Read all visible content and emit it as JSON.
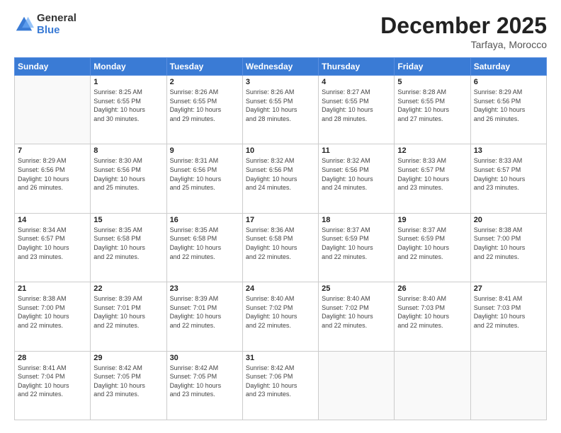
{
  "logo": {
    "general": "General",
    "blue": "Blue"
  },
  "header": {
    "month": "December 2025",
    "location": "Tarfaya, Morocco"
  },
  "weekdays": [
    "Sunday",
    "Monday",
    "Tuesday",
    "Wednesday",
    "Thursday",
    "Friday",
    "Saturday"
  ],
  "weeks": [
    [
      {
        "day": "",
        "info": ""
      },
      {
        "day": "1",
        "info": "Sunrise: 8:25 AM\nSunset: 6:55 PM\nDaylight: 10 hours\nand 30 minutes."
      },
      {
        "day": "2",
        "info": "Sunrise: 8:26 AM\nSunset: 6:55 PM\nDaylight: 10 hours\nand 29 minutes."
      },
      {
        "day": "3",
        "info": "Sunrise: 8:26 AM\nSunset: 6:55 PM\nDaylight: 10 hours\nand 28 minutes."
      },
      {
        "day": "4",
        "info": "Sunrise: 8:27 AM\nSunset: 6:55 PM\nDaylight: 10 hours\nand 28 minutes."
      },
      {
        "day": "5",
        "info": "Sunrise: 8:28 AM\nSunset: 6:55 PM\nDaylight: 10 hours\nand 27 minutes."
      },
      {
        "day": "6",
        "info": "Sunrise: 8:29 AM\nSunset: 6:56 PM\nDaylight: 10 hours\nand 26 minutes."
      }
    ],
    [
      {
        "day": "7",
        "info": "Sunrise: 8:29 AM\nSunset: 6:56 PM\nDaylight: 10 hours\nand 26 minutes."
      },
      {
        "day": "8",
        "info": "Sunrise: 8:30 AM\nSunset: 6:56 PM\nDaylight: 10 hours\nand 25 minutes."
      },
      {
        "day": "9",
        "info": "Sunrise: 8:31 AM\nSunset: 6:56 PM\nDaylight: 10 hours\nand 25 minutes."
      },
      {
        "day": "10",
        "info": "Sunrise: 8:32 AM\nSunset: 6:56 PM\nDaylight: 10 hours\nand 24 minutes."
      },
      {
        "day": "11",
        "info": "Sunrise: 8:32 AM\nSunset: 6:56 PM\nDaylight: 10 hours\nand 24 minutes."
      },
      {
        "day": "12",
        "info": "Sunrise: 8:33 AM\nSunset: 6:57 PM\nDaylight: 10 hours\nand 23 minutes."
      },
      {
        "day": "13",
        "info": "Sunrise: 8:33 AM\nSunset: 6:57 PM\nDaylight: 10 hours\nand 23 minutes."
      }
    ],
    [
      {
        "day": "14",
        "info": "Sunrise: 8:34 AM\nSunset: 6:57 PM\nDaylight: 10 hours\nand 23 minutes."
      },
      {
        "day": "15",
        "info": "Sunrise: 8:35 AM\nSunset: 6:58 PM\nDaylight: 10 hours\nand 22 minutes."
      },
      {
        "day": "16",
        "info": "Sunrise: 8:35 AM\nSunset: 6:58 PM\nDaylight: 10 hours\nand 22 minutes."
      },
      {
        "day": "17",
        "info": "Sunrise: 8:36 AM\nSunset: 6:58 PM\nDaylight: 10 hours\nand 22 minutes."
      },
      {
        "day": "18",
        "info": "Sunrise: 8:37 AM\nSunset: 6:59 PM\nDaylight: 10 hours\nand 22 minutes."
      },
      {
        "day": "19",
        "info": "Sunrise: 8:37 AM\nSunset: 6:59 PM\nDaylight: 10 hours\nand 22 minutes."
      },
      {
        "day": "20",
        "info": "Sunrise: 8:38 AM\nSunset: 7:00 PM\nDaylight: 10 hours\nand 22 minutes."
      }
    ],
    [
      {
        "day": "21",
        "info": "Sunrise: 8:38 AM\nSunset: 7:00 PM\nDaylight: 10 hours\nand 22 minutes."
      },
      {
        "day": "22",
        "info": "Sunrise: 8:39 AM\nSunset: 7:01 PM\nDaylight: 10 hours\nand 22 minutes."
      },
      {
        "day": "23",
        "info": "Sunrise: 8:39 AM\nSunset: 7:01 PM\nDaylight: 10 hours\nand 22 minutes."
      },
      {
        "day": "24",
        "info": "Sunrise: 8:40 AM\nSunset: 7:02 PM\nDaylight: 10 hours\nand 22 minutes."
      },
      {
        "day": "25",
        "info": "Sunrise: 8:40 AM\nSunset: 7:02 PM\nDaylight: 10 hours\nand 22 minutes."
      },
      {
        "day": "26",
        "info": "Sunrise: 8:40 AM\nSunset: 7:03 PM\nDaylight: 10 hours\nand 22 minutes."
      },
      {
        "day": "27",
        "info": "Sunrise: 8:41 AM\nSunset: 7:03 PM\nDaylight: 10 hours\nand 22 minutes."
      }
    ],
    [
      {
        "day": "28",
        "info": "Sunrise: 8:41 AM\nSunset: 7:04 PM\nDaylight: 10 hours\nand 22 minutes."
      },
      {
        "day": "29",
        "info": "Sunrise: 8:42 AM\nSunset: 7:05 PM\nDaylight: 10 hours\nand 23 minutes."
      },
      {
        "day": "30",
        "info": "Sunrise: 8:42 AM\nSunset: 7:05 PM\nDaylight: 10 hours\nand 23 minutes."
      },
      {
        "day": "31",
        "info": "Sunrise: 8:42 AM\nSunset: 7:06 PM\nDaylight: 10 hours\nand 23 minutes."
      },
      {
        "day": "",
        "info": ""
      },
      {
        "day": "",
        "info": ""
      },
      {
        "day": "",
        "info": ""
      }
    ]
  ]
}
